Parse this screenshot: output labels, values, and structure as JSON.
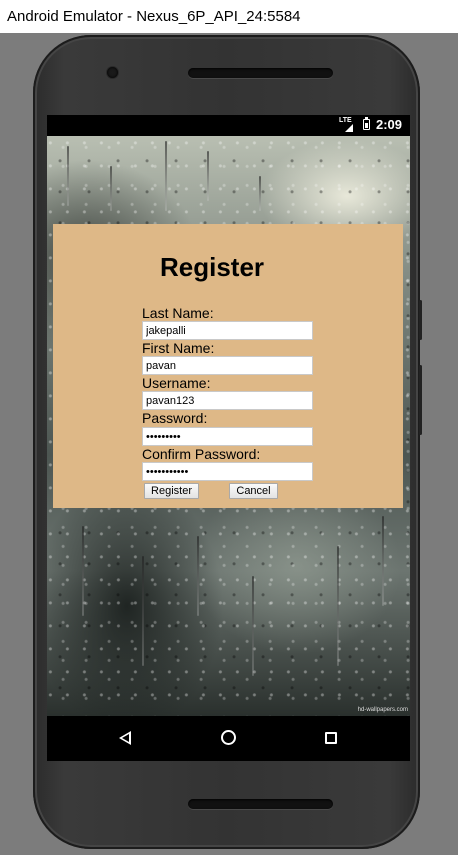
{
  "window": {
    "title": "Android Emulator - Nexus_6P_API_24:5584"
  },
  "status_bar": {
    "network": "LTE",
    "time": "2:09"
  },
  "wallpaper": {
    "watermark": "hd-wallpapers.com"
  },
  "form": {
    "title": "Register",
    "fields": [
      {
        "label": "Last Name:",
        "value": "jakepalli",
        "type": "text"
      },
      {
        "label": "First Name:",
        "value": "pavan",
        "type": "text"
      },
      {
        "label": "Username:",
        "value": "pavan123",
        "type": "text"
      },
      {
        "label": "Password:",
        "value": "•••••••••",
        "type": "password"
      },
      {
        "label": "Confirm Password:",
        "value": "•••••••••••",
        "type": "password"
      }
    ],
    "register_button": "Register",
    "cancel_button": "Cancel",
    "background_color": "#deb887"
  },
  "nav_bar": {
    "icons": [
      "back-icon",
      "home-icon",
      "recents-icon"
    ]
  }
}
